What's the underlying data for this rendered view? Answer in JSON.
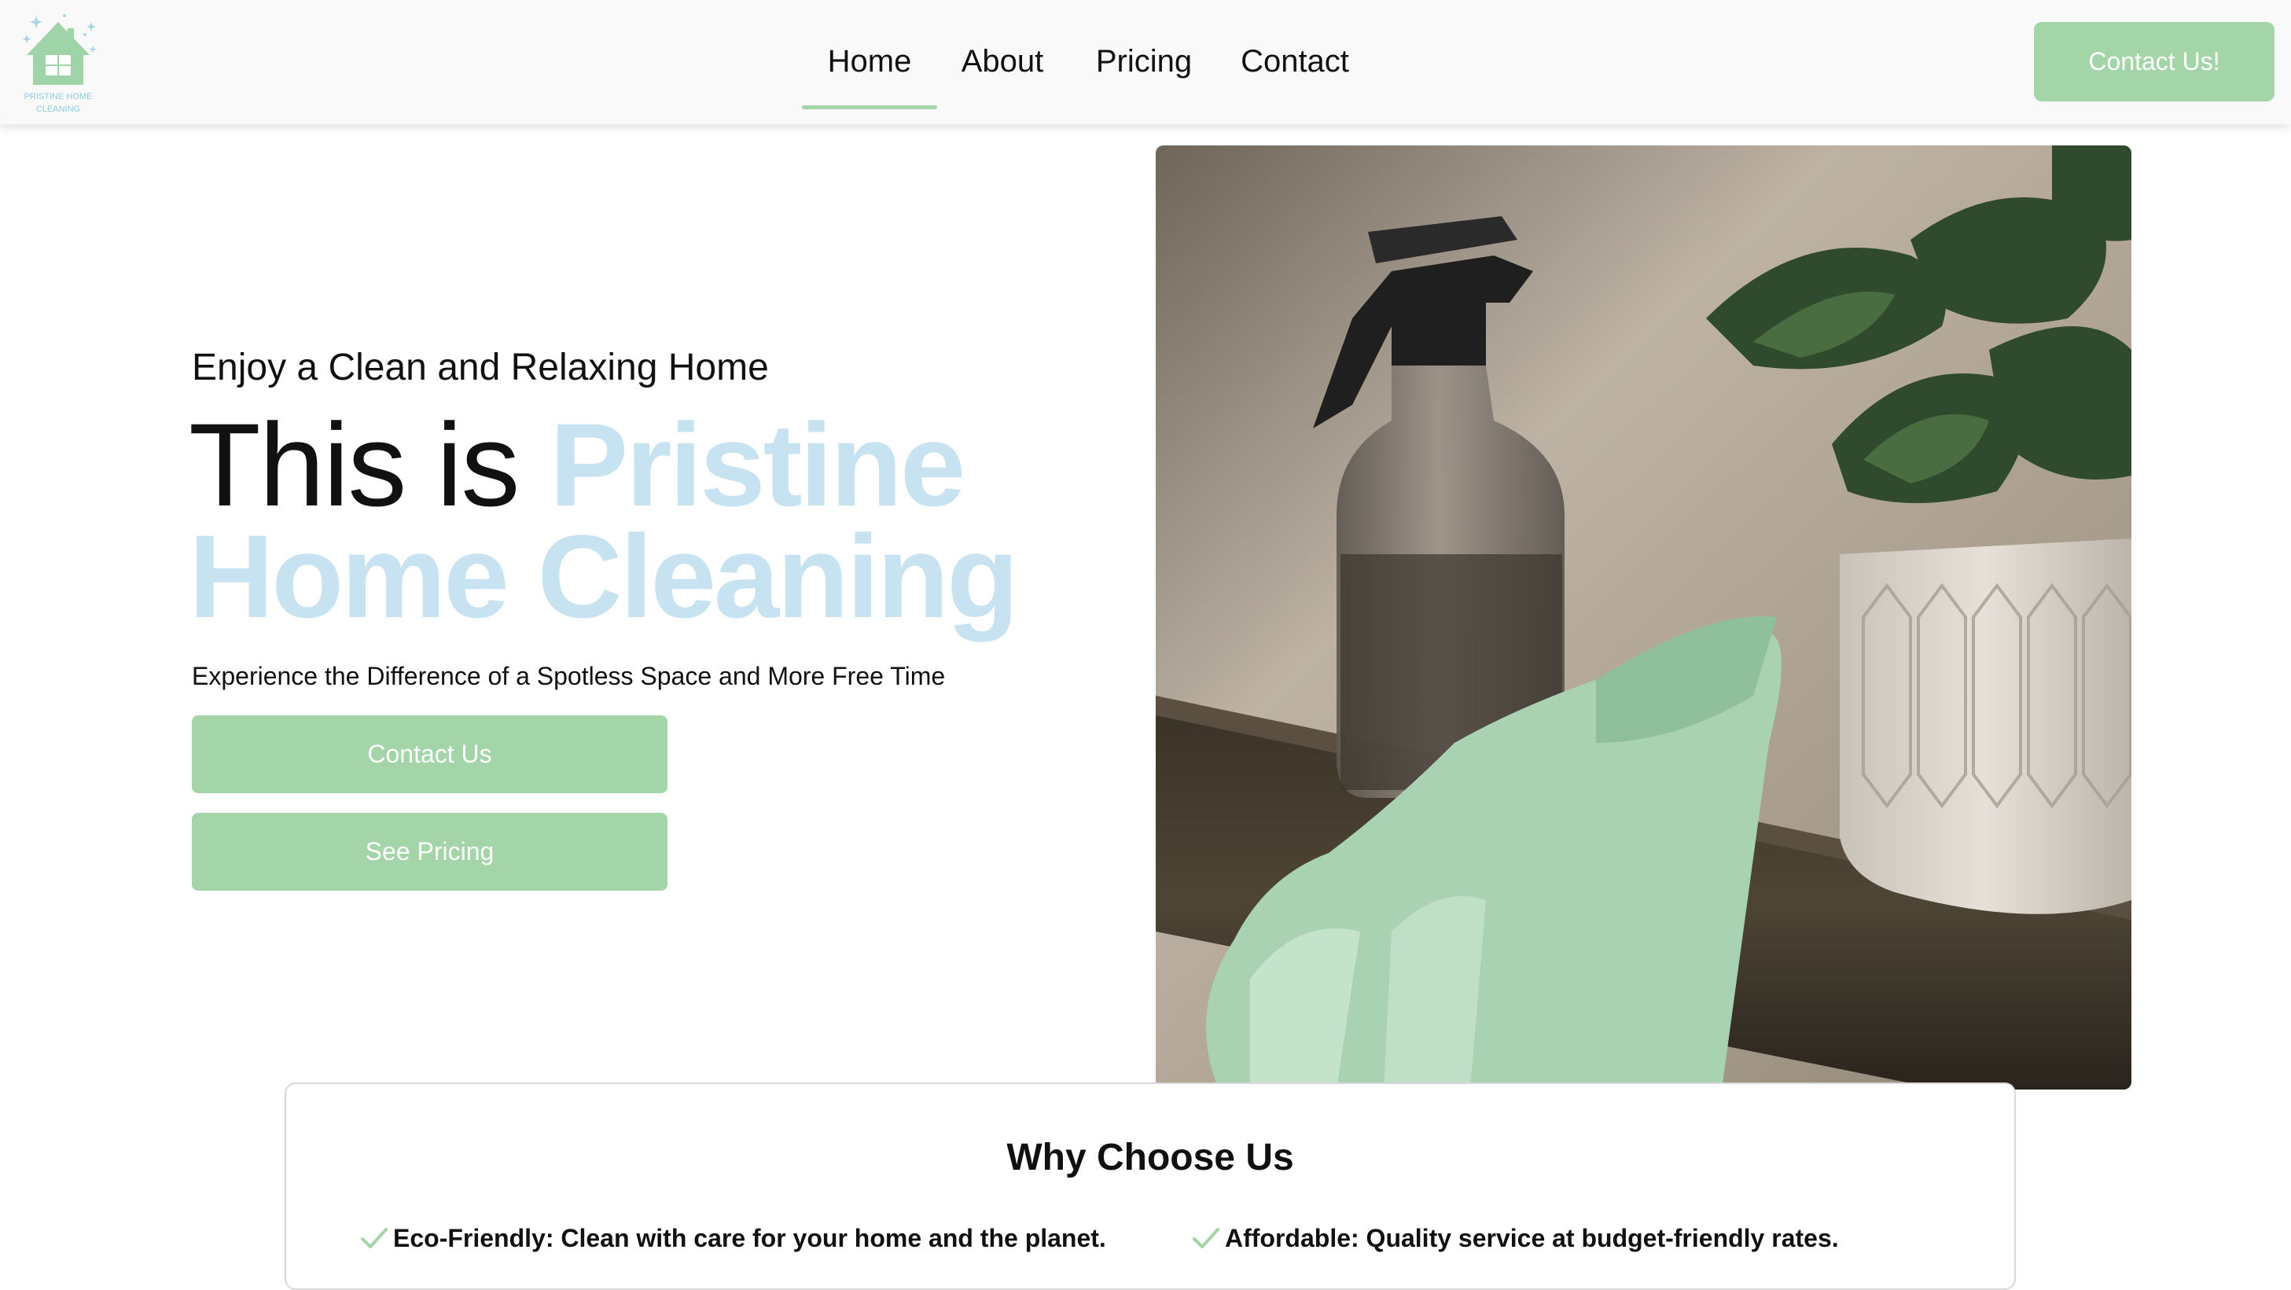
{
  "brand": {
    "logo_text_line1": "PRISTINE HOME",
    "logo_text_line2": "CLEANING",
    "accent_green": "#a3d5a8",
    "accent_blue": "#c7e3f2"
  },
  "nav": {
    "items": [
      {
        "label": "Home",
        "active": true
      },
      {
        "label": "About",
        "active": false
      },
      {
        "label": "Pricing",
        "active": false
      },
      {
        "label": "Contact",
        "active": false
      }
    ],
    "cta_label": "Contact Us!"
  },
  "hero": {
    "tagline": "Enjoy a Clean and Relaxing Home",
    "headline_plain": "This is ",
    "headline_brand": "Pristine Home Cleaning",
    "subline": "Experience the Difference of a Spotless Space and More Free Time",
    "buttons": [
      {
        "label": "Contact Us"
      },
      {
        "label": "See Pricing"
      }
    ],
    "photo_alt": "spray bottle, rubber glove and potted plant on a wooden shelf"
  },
  "why_choose_us": {
    "title": "Why Choose Us",
    "items": [
      {
        "icon": "check-icon",
        "text": "Eco-Friendly: Clean with care for your home and the planet."
      },
      {
        "icon": "check-icon",
        "text": "Affordable: Quality service at budget-friendly rates."
      }
    ]
  }
}
